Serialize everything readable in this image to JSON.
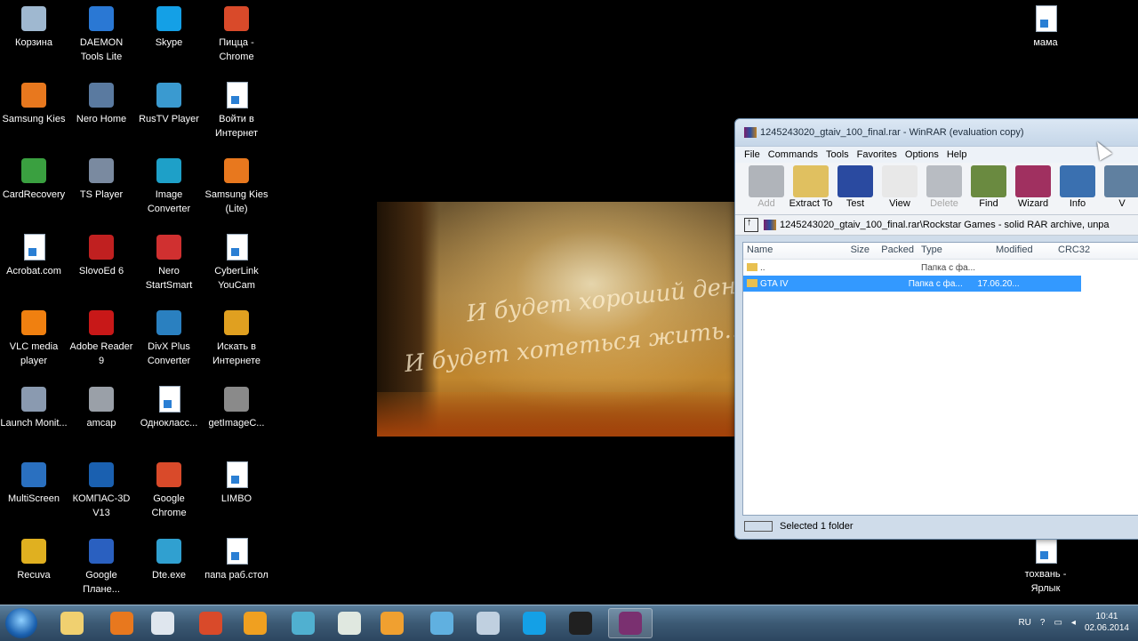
{
  "desktop_icons": [
    {
      "label": "Корзина",
      "color": "#9fb8d0"
    },
    {
      "label": "DAEMON Tools Lite",
      "color": "#2a78d4"
    },
    {
      "label": "Skype",
      "color": "#14a0e6"
    },
    {
      "label": "Пицца - Chrome",
      "color": "#d94a2a"
    },
    {
      "label": "Samsung Kies",
      "color": "#e8781e"
    },
    {
      "label": "Nero Home",
      "color": "#5a7aa0"
    },
    {
      "label": "RusTV Player",
      "color": "#3a9ad0"
    },
    {
      "label": "Войти в Интернет",
      "color": "#ffffff"
    },
    {
      "label": "CardRecovery",
      "color": "#3aa040"
    },
    {
      "label": "TS Player",
      "color": "#7a8aa0"
    },
    {
      "label": "Image Converter",
      "color": "#1ea0c8"
    },
    {
      "label": "Samsung Kies (Lite)",
      "color": "#e8781e"
    },
    {
      "label": "Acrobat.com",
      "color": "#ffffff"
    },
    {
      "label": "SlovoEd 6",
      "color": "#c02020"
    },
    {
      "label": "Nero StartSmart",
      "color": "#d03030"
    },
    {
      "label": "CyberLink YouCam",
      "color": "#ffffff"
    },
    {
      "label": "VLC media player",
      "color": "#f08010"
    },
    {
      "label": "Adobe Reader 9",
      "color": "#c81818"
    },
    {
      "label": "DivX Plus Converter",
      "color": "#2a80c0"
    },
    {
      "label": "Искать в Интернете",
      "color": "#e0a020"
    },
    {
      "label": "Launch Monit...",
      "color": "#8a9ab0"
    },
    {
      "label": "amcap",
      "color": "#9aa0a8"
    },
    {
      "label": "Однокласс...",
      "color": "#ffffff"
    },
    {
      "label": "getImageC...",
      "color": "#8a8a8a"
    },
    {
      "label": "MultiScreen",
      "color": "#2a70c0"
    },
    {
      "label": "КОМПАС-3D V13",
      "color": "#1a60b0"
    },
    {
      "label": "Google Chrome",
      "color": "#d94a2a"
    },
    {
      "label": "LIMBO",
      "color": "#ffffff"
    },
    {
      "label": "Recuva",
      "color": "#e0b020"
    },
    {
      "label": "Google Плане...",
      "color": "#2a60c0"
    },
    {
      "label": "Dte.exe",
      "color": "#30a0d0"
    },
    {
      "label": "папа раб.стол",
      "color": "#ffffff"
    }
  ],
  "right_icons": [
    {
      "label": "мама",
      "color": "#ffffff"
    },
    {
      "label": "тохвань - Ярлык",
      "color": "#ffffff"
    }
  ],
  "wallpaper": {
    "line1": "И будет хороший день",
    "line2": "И будет хотеться жить..."
  },
  "winrar": {
    "title": "1245243020_gtaiv_100_final.rar - WinRAR (evaluation copy)",
    "menu": [
      "File",
      "Commands",
      "Tools",
      "Favorites",
      "Options",
      "Help"
    ],
    "toolbar": [
      {
        "label": "Add",
        "enabled": false,
        "color": "#b0b4ba"
      },
      {
        "label": "Extract To",
        "enabled": true,
        "color": "#e0c060"
      },
      {
        "label": "Test",
        "enabled": true,
        "color": "#2a4aa0"
      },
      {
        "label": "View",
        "enabled": true,
        "color": "#e8e8e8"
      },
      {
        "label": "Delete",
        "enabled": false,
        "color": "#b8bcc2"
      },
      {
        "label": "Find",
        "enabled": true,
        "color": "#6a8a40"
      },
      {
        "label": "Wizard",
        "enabled": true,
        "color": "#a03060"
      },
      {
        "label": "Info",
        "enabled": true,
        "color": "#3a70b0"
      },
      {
        "label": "V",
        "enabled": true,
        "color": "#6080a0"
      }
    ],
    "path": "1245243020_gtaiv_100_final.rar\\Rockstar Games - solid RAR archive, unpa",
    "columns": [
      "Name",
      "Size",
      "Packed",
      "Type",
      "Modified",
      "CRC32"
    ],
    "rows": [
      {
        "name": "..",
        "size": "",
        "packed": "",
        "type": "Папка с фа...",
        "modified": "",
        "crc": "",
        "selected": false
      },
      {
        "name": "GTA IV",
        "size": "",
        "packed": "",
        "type": "Папка с фа...",
        "modified": "17.06.20...",
        "crc": "",
        "selected": true
      }
    ],
    "status": "Selected 1 folder"
  },
  "taskbar": {
    "apps": [
      {
        "name": "explorer",
        "color": "#f0d070",
        "active": false
      },
      {
        "name": "samsung-kies",
        "color": "#e8781e",
        "active": false
      },
      {
        "name": "window",
        "color": "#dfe6ee",
        "active": false
      },
      {
        "name": "chrome",
        "color": "#d94a2a",
        "active": false
      },
      {
        "name": "media-player",
        "color": "#f0a020",
        "active": false
      },
      {
        "name": "browser",
        "color": "#50b0d0",
        "active": false
      },
      {
        "name": "app",
        "color": "#e0e8e0",
        "active": false
      },
      {
        "name": "messenger",
        "color": "#f0a030",
        "active": false
      },
      {
        "name": "browser-2",
        "color": "#60b0e0",
        "active": false
      },
      {
        "name": "volume",
        "color": "#c0d0e0",
        "active": false
      },
      {
        "name": "skype",
        "color": "#14a0e6",
        "active": false
      },
      {
        "name": "obs",
        "color": "#202020",
        "active": false
      },
      {
        "name": "winrar",
        "color": "#7a3070",
        "active": true
      }
    ],
    "lang": "RU",
    "time": "10:41",
    "date": "02.06.2014"
  }
}
